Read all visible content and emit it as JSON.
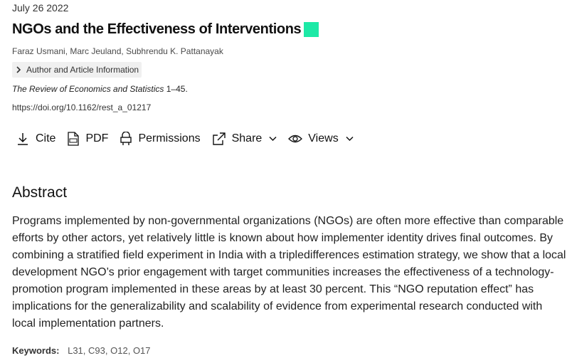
{
  "article": {
    "date": "July 26 2022",
    "title": "NGOs and the Effectiveness of Interventions",
    "authors": [
      "Faraz Usmani",
      "Marc Jeuland",
      "Subhrendu K. Pattanayak"
    ],
    "author_info_label": "Author and Article Information",
    "journal": "The Review of Economics and Statistics",
    "pages": " 1–45.",
    "doi": "https://doi.org/10.1162/rest_a_01217"
  },
  "toolbar": {
    "cite": "Cite",
    "pdf": "PDF",
    "permissions": "Permissions",
    "share": "Share",
    "views": "Views"
  },
  "abstract": {
    "heading": "Abstract",
    "text": "Programs implemented by non-governmental organizations (NGOs) are often more effective than comparable efforts by other actors, yet relatively little is known about how implementer identity drives final outcomes. By combining a stratified field experiment in India with a tripledifferences estimation strategy, we show that a local development NGO’s prior engagement with target communities increases the effectiveness of a technology-promotion program implemented in these areas by at least 30 percent. This “NGO reputation effect” has implications for the generalizability and scalability of evidence from experimental research conducted with local implementation partners."
  },
  "keywords": {
    "label": "Keywords:",
    "items": [
      "L31",
      "C93",
      "O12",
      "O17"
    ]
  },
  "colors": {
    "open_access_badge": "#1de9a6"
  },
  "icons": [
    "download-icon",
    "pdf-icon",
    "permissions-icon",
    "share-icon",
    "eye-icon",
    "chevron-down-icon",
    "chevron-right-icon"
  ]
}
